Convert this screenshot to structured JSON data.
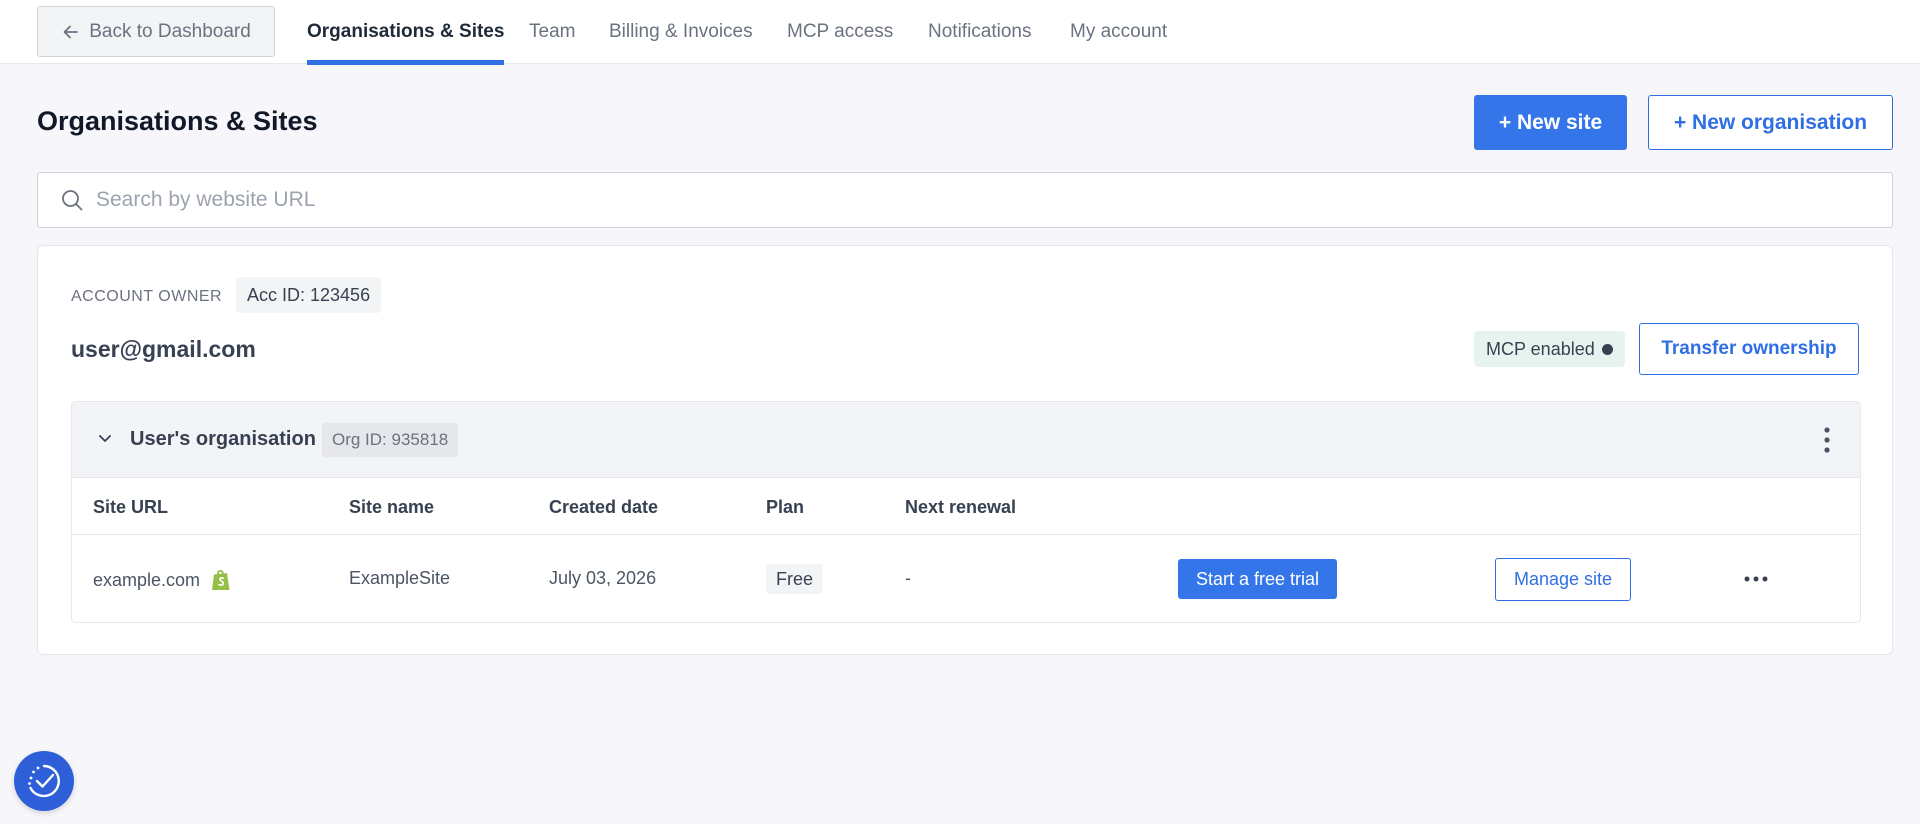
{
  "nav": {
    "back_label": "Back to Dashboard",
    "tabs": [
      {
        "label": "Organisations & Sites",
        "active": true
      },
      {
        "label": "Team"
      },
      {
        "label": "Billing & Invoices"
      },
      {
        "label": "MCP access"
      },
      {
        "label": "Notifications"
      },
      {
        "label": "My account"
      }
    ]
  },
  "header": {
    "title": "Organisations & Sites",
    "new_site_label": "+ New site",
    "new_org_label": "+ New organisation"
  },
  "search": {
    "placeholder": "Search by website URL",
    "value": ""
  },
  "account": {
    "owner_label": "ACCOUNT OWNER",
    "acc_id": "Acc ID: 123456",
    "email": "user@gmail.com",
    "mcp_badge": "MCP enabled",
    "transfer_label": "Transfer ownership"
  },
  "organisation": {
    "name": "User's organisation",
    "org_id": "Org ID: 935818",
    "columns": [
      "Site URL",
      "Site name",
      "Created date",
      "Plan",
      "Next renewal"
    ],
    "rows": [
      {
        "url": "example.com",
        "platform_icon": "shopify-icon",
        "site_name": "ExampleSite",
        "created": "July 03, 2026",
        "plan": "Free",
        "renewal": "-",
        "trial_label": "Start a free trial",
        "manage_label": "Manage site"
      }
    ]
  },
  "colors": {
    "accent": "#3476ea",
    "mcp_badge_bg": "#e7f3ee",
    "fab": "#2e5fd8"
  }
}
